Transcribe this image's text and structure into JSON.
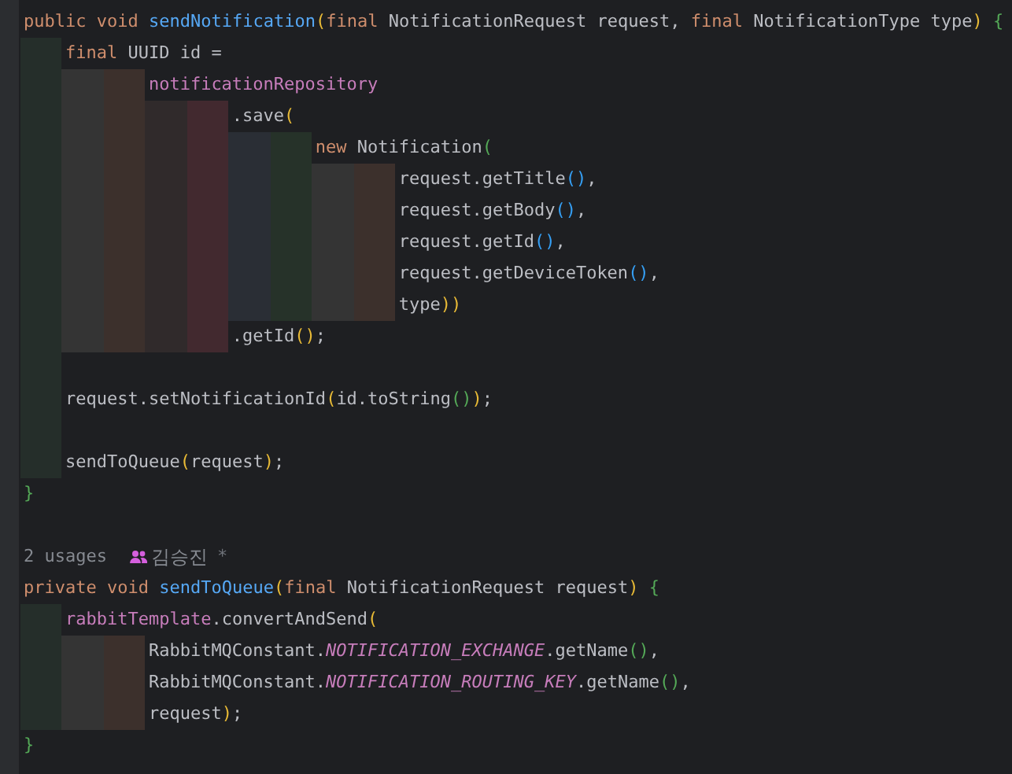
{
  "editor": {
    "lines": [
      {
        "tokens": [
          {
            "text": "public void ",
            "kind": "kw"
          },
          {
            "text": "sendNotification",
            "kind": "fn"
          },
          {
            "text": "(",
            "kind": "p1"
          },
          {
            "text": "final ",
            "kind": "kw"
          },
          {
            "text": "NotificationRequest request, ",
            "kind": "plain"
          },
          {
            "text": "final ",
            "kind": "kw"
          },
          {
            "text": "NotificationType type",
            "kind": "plain"
          },
          {
            "text": ")",
            "kind": "p1"
          },
          {
            "text": " {",
            "kind": "p2"
          }
        ]
      },
      {
        "guides": [
          {
            "color": "#252e2a"
          }
        ],
        "tokens": [
          {
            "text": "final ",
            "kind": "kw"
          },
          {
            "text": "UUID id =",
            "kind": "plain"
          }
        ]
      },
      {
        "guides": [
          {
            "color": "#252e2a"
          },
          {
            "color": "#343434"
          },
          {
            "color": "#3c302c"
          }
        ],
        "tokens": [
          {
            "text": "notificationRepository",
            "kind": "field"
          }
        ]
      },
      {
        "guides": [
          {
            "color": "#252e2a"
          },
          {
            "color": "#343434"
          },
          {
            "color": "#3c302c"
          },
          {
            "color": "#302a2b"
          },
          {
            "color": "#42292f"
          }
        ],
        "tokens": [
          {
            "text": ".save",
            "kind": "plain"
          },
          {
            "text": "(",
            "kind": "p1"
          }
        ]
      },
      {
        "guides": [
          {
            "color": "#252e2a"
          },
          {
            "color": "#343434"
          },
          {
            "color": "#3c302c"
          },
          {
            "color": "#302a2b"
          },
          {
            "color": "#42292f"
          },
          {
            "color": "#2a2e35"
          },
          {
            "color": "#263229"
          }
        ],
        "tokens": [
          {
            "text": "new ",
            "kind": "kw"
          },
          {
            "text": "Notification",
            "kind": "plain"
          },
          {
            "text": "(",
            "kind": "p2"
          }
        ]
      },
      {
        "guides": [
          {
            "color": "#252e2a"
          },
          {
            "color": "#343434"
          },
          {
            "color": "#3c302c"
          },
          {
            "color": "#302a2b"
          },
          {
            "color": "#42292f"
          },
          {
            "color": "#2a2e35"
          },
          {
            "color": "#263229"
          },
          {
            "color": "#343434"
          },
          {
            "color": "#3c302c"
          }
        ],
        "tokens": [
          {
            "text": "request.getTitle",
            "kind": "plain"
          },
          {
            "text": "()",
            "kind": "p3"
          },
          {
            "text": ",",
            "kind": "plain"
          }
        ]
      },
      {
        "guides": [
          {
            "color": "#252e2a"
          },
          {
            "color": "#343434"
          },
          {
            "color": "#3c302c"
          },
          {
            "color": "#302a2b"
          },
          {
            "color": "#42292f"
          },
          {
            "color": "#2a2e35"
          },
          {
            "color": "#263229"
          },
          {
            "color": "#343434"
          },
          {
            "color": "#3c302c"
          }
        ],
        "tokens": [
          {
            "text": "request.getBody",
            "kind": "plain"
          },
          {
            "text": "()",
            "kind": "p3"
          },
          {
            "text": ",",
            "kind": "plain"
          }
        ]
      },
      {
        "guides": [
          {
            "color": "#252e2a"
          },
          {
            "color": "#343434"
          },
          {
            "color": "#3c302c"
          },
          {
            "color": "#302a2b"
          },
          {
            "color": "#42292f"
          },
          {
            "color": "#2a2e35"
          },
          {
            "color": "#263229"
          },
          {
            "color": "#343434"
          },
          {
            "color": "#3c302c"
          }
        ],
        "tokens": [
          {
            "text": "request.getId",
            "kind": "plain"
          },
          {
            "text": "()",
            "kind": "p3"
          },
          {
            "text": ",",
            "kind": "plain"
          }
        ]
      },
      {
        "guides": [
          {
            "color": "#252e2a"
          },
          {
            "color": "#343434"
          },
          {
            "color": "#3c302c"
          },
          {
            "color": "#302a2b"
          },
          {
            "color": "#42292f"
          },
          {
            "color": "#2a2e35"
          },
          {
            "color": "#263229"
          },
          {
            "color": "#343434"
          },
          {
            "color": "#3c302c"
          }
        ],
        "tokens": [
          {
            "text": "request.getDeviceToken",
            "kind": "plain"
          },
          {
            "text": "()",
            "kind": "p3"
          },
          {
            "text": ",",
            "kind": "plain"
          }
        ]
      },
      {
        "guides": [
          {
            "color": "#252e2a"
          },
          {
            "color": "#343434"
          },
          {
            "color": "#3c302c"
          },
          {
            "color": "#302a2b"
          },
          {
            "color": "#42292f"
          },
          {
            "color": "#2a2e35"
          },
          {
            "color": "#263229"
          },
          {
            "color": "#343434"
          },
          {
            "color": "#3c302c"
          }
        ],
        "tokens": [
          {
            "text": "type",
            "kind": "plain"
          },
          {
            "text": "))",
            "kind": "p1"
          }
        ]
      },
      {
        "guides": [
          {
            "color": "#252e2a"
          },
          {
            "color": "#343434"
          },
          {
            "color": "#3c302c"
          },
          {
            "color": "#302a2b"
          },
          {
            "color": "#42292f"
          }
        ],
        "tokens": [
          {
            "text": ".getId",
            "kind": "plain"
          },
          {
            "text": "()",
            "kind": "p1"
          },
          {
            "text": ";",
            "kind": "plain"
          }
        ]
      },
      {
        "guides": [
          {
            "color": "#252e2a"
          }
        ]
      },
      {
        "guides": [
          {
            "color": "#252e2a"
          }
        ],
        "tokens": [
          {
            "text": "request.setNotificationId",
            "kind": "plain"
          },
          {
            "text": "(",
            "kind": "p1"
          },
          {
            "text": "id.toString",
            "kind": "plain"
          },
          {
            "text": "()",
            "kind": "p2"
          },
          {
            "text": ")",
            "kind": "p1"
          },
          {
            "text": ";",
            "kind": "plain"
          }
        ]
      },
      {
        "guides": [
          {
            "color": "#252e2a"
          }
        ]
      },
      {
        "guides": [
          {
            "color": "#252e2a"
          }
        ],
        "tokens": [
          {
            "text": "sendToQueue",
            "kind": "plain"
          },
          {
            "text": "(",
            "kind": "p1"
          },
          {
            "text": "request",
            "kind": "plain"
          },
          {
            "text": ")",
            "kind": "p1"
          },
          {
            "text": ";",
            "kind": "plain"
          }
        ]
      },
      {
        "tokens": [
          {
            "text": "}",
            "kind": "p2"
          }
        ]
      },
      {
        "kind": "hint",
        "tokens": [
          {
            "text": "2 usages",
            "kind": "usages"
          },
          {
            "text": "김승진",
            "kind": "author"
          },
          {
            "text": "*",
            "kind": "marker"
          }
        ]
      },
      {
        "tokens": [
          {
            "text": "private void ",
            "kind": "kw"
          },
          {
            "text": "sendToQueue",
            "kind": "fn"
          },
          {
            "text": "(",
            "kind": "p1"
          },
          {
            "text": "final ",
            "kind": "kw"
          },
          {
            "text": "NotificationRequest request",
            "kind": "plain"
          },
          {
            "text": ")",
            "kind": "p1"
          },
          {
            "text": " {",
            "kind": "p2"
          }
        ]
      },
      {
        "guides": [
          {
            "color": "#252e2a"
          }
        ],
        "tokens": [
          {
            "text": "rabbitTemplate",
            "kind": "field"
          },
          {
            "text": ".convertAndSend",
            "kind": "plain"
          },
          {
            "text": "(",
            "kind": "p1"
          }
        ]
      },
      {
        "guides": [
          {
            "color": "#252e2a"
          },
          {
            "color": "#343434"
          },
          {
            "color": "#3c302c"
          }
        ],
        "tokens": [
          {
            "text": "RabbitMQConstant.",
            "kind": "plain"
          },
          {
            "text": "NOTIFICATION_EXCHANGE",
            "kind": "const"
          },
          {
            "text": ".getName",
            "kind": "plain"
          },
          {
            "text": "()",
            "kind": "p2"
          },
          {
            "text": ",",
            "kind": "plain"
          }
        ]
      },
      {
        "guides": [
          {
            "color": "#252e2a"
          },
          {
            "color": "#343434"
          },
          {
            "color": "#3c302c"
          }
        ],
        "tokens": [
          {
            "text": "RabbitMQConstant.",
            "kind": "plain"
          },
          {
            "text": "NOTIFICATION_ROUTING_KEY",
            "kind": "const"
          },
          {
            "text": ".getName",
            "kind": "plain"
          },
          {
            "text": "()",
            "kind": "p2"
          },
          {
            "text": ",",
            "kind": "plain"
          }
        ]
      },
      {
        "guides": [
          {
            "color": "#252e2a"
          },
          {
            "color": "#343434"
          },
          {
            "color": "#3c302c"
          }
        ],
        "tokens": [
          {
            "text": "request",
            "kind": "plain"
          },
          {
            "text": ")",
            "kind": "p1"
          },
          {
            "text": ";",
            "kind": "plain"
          }
        ]
      },
      {
        "tokens": [
          {
            "text": "}",
            "kind": "p2"
          }
        ]
      }
    ]
  }
}
